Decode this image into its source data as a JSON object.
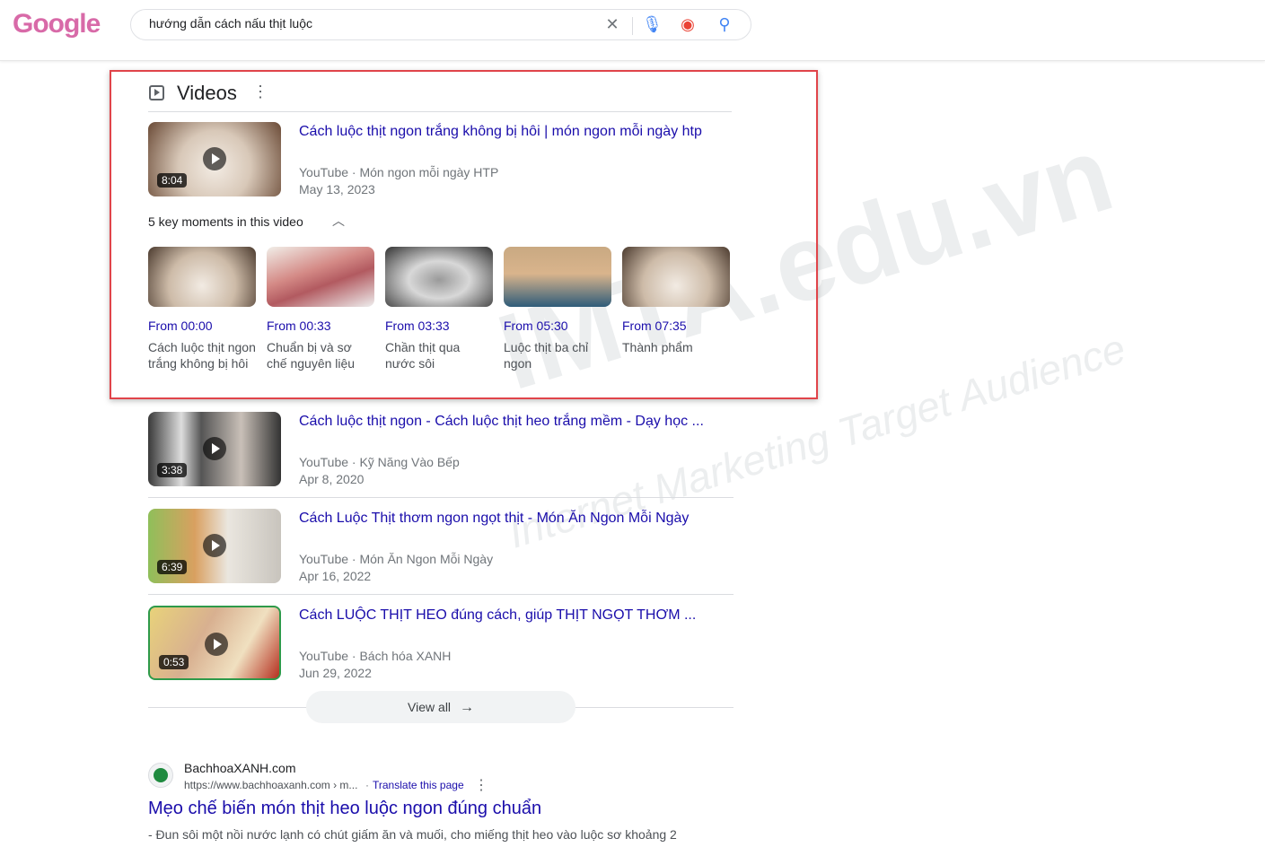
{
  "header": {
    "logo": "Google",
    "query": "hướng dẫn cách nấu thịt luộc"
  },
  "videos": {
    "heading": "Videos",
    "items": [
      {
        "title": "Cách luộc thịt ngon trắng không bị hôi | món ngon mỗi ngày htp",
        "source": "YouTube · Món ngon mỗi ngày HTP",
        "date": "May 13, 2023",
        "duration": "8:04"
      },
      {
        "title": "Cách luộc thịt ngon - Cách luộc thịt heo trắng mềm - Dạy học ...",
        "source": "YouTube · Kỹ Năng Vào Bếp",
        "date": "Apr 8, 2020",
        "duration": "3:38"
      },
      {
        "title": "Cách Luộc Thịt thơm ngon ngọt thịt - Món Ăn Ngon Mỗi Ngày",
        "source": "YouTube · Món Ăn Ngon Mỗi Ngày",
        "date": "Apr 16, 2022",
        "duration": "6:39"
      },
      {
        "title": "Cách LUỘC THỊT HEO đúng cách, giúp THỊT NGỌT THƠM ...",
        "source": "YouTube · Bách hóa XANH",
        "date": "Jun 29, 2022",
        "duration": "0:53"
      }
    ],
    "key_moments_label": "5 key moments in this video",
    "moments": [
      {
        "from": "From 00:00",
        "label": "Cách luộc thịt ngon trắng không bị hôi"
      },
      {
        "from": "From 00:33",
        "label": "Chuẩn bị và sơ chế nguyên liệu"
      },
      {
        "from": "From 03:33",
        "label": "Chần thịt qua nước sôi"
      },
      {
        "from": "From 05:30",
        "label": "Luộc thịt ba chỉ ngon"
      },
      {
        "from": "From 07:35",
        "label": "Thành phẩm"
      }
    ],
    "view_all": "View all"
  },
  "result": {
    "site": "BachhoaXANH.com",
    "url": "https://www.bachhoaxanh.com › m...",
    "translate": "Translate this page",
    "title": "Mẹo chế biến món thịt heo luộc ngon đúng chuẩn",
    "snippet": "- Đun sôi một nồi nước lạnh có chút giấm ăn và muối, cho miếng thịt heo vào luộc sơ khoảng 2"
  },
  "watermark": {
    "main": "IMTA.edu.vn",
    "sub": "Internet Marketing Target Audience"
  },
  "colors": {
    "link": "#1a0dab",
    "highlight_box": "#e0444a"
  }
}
